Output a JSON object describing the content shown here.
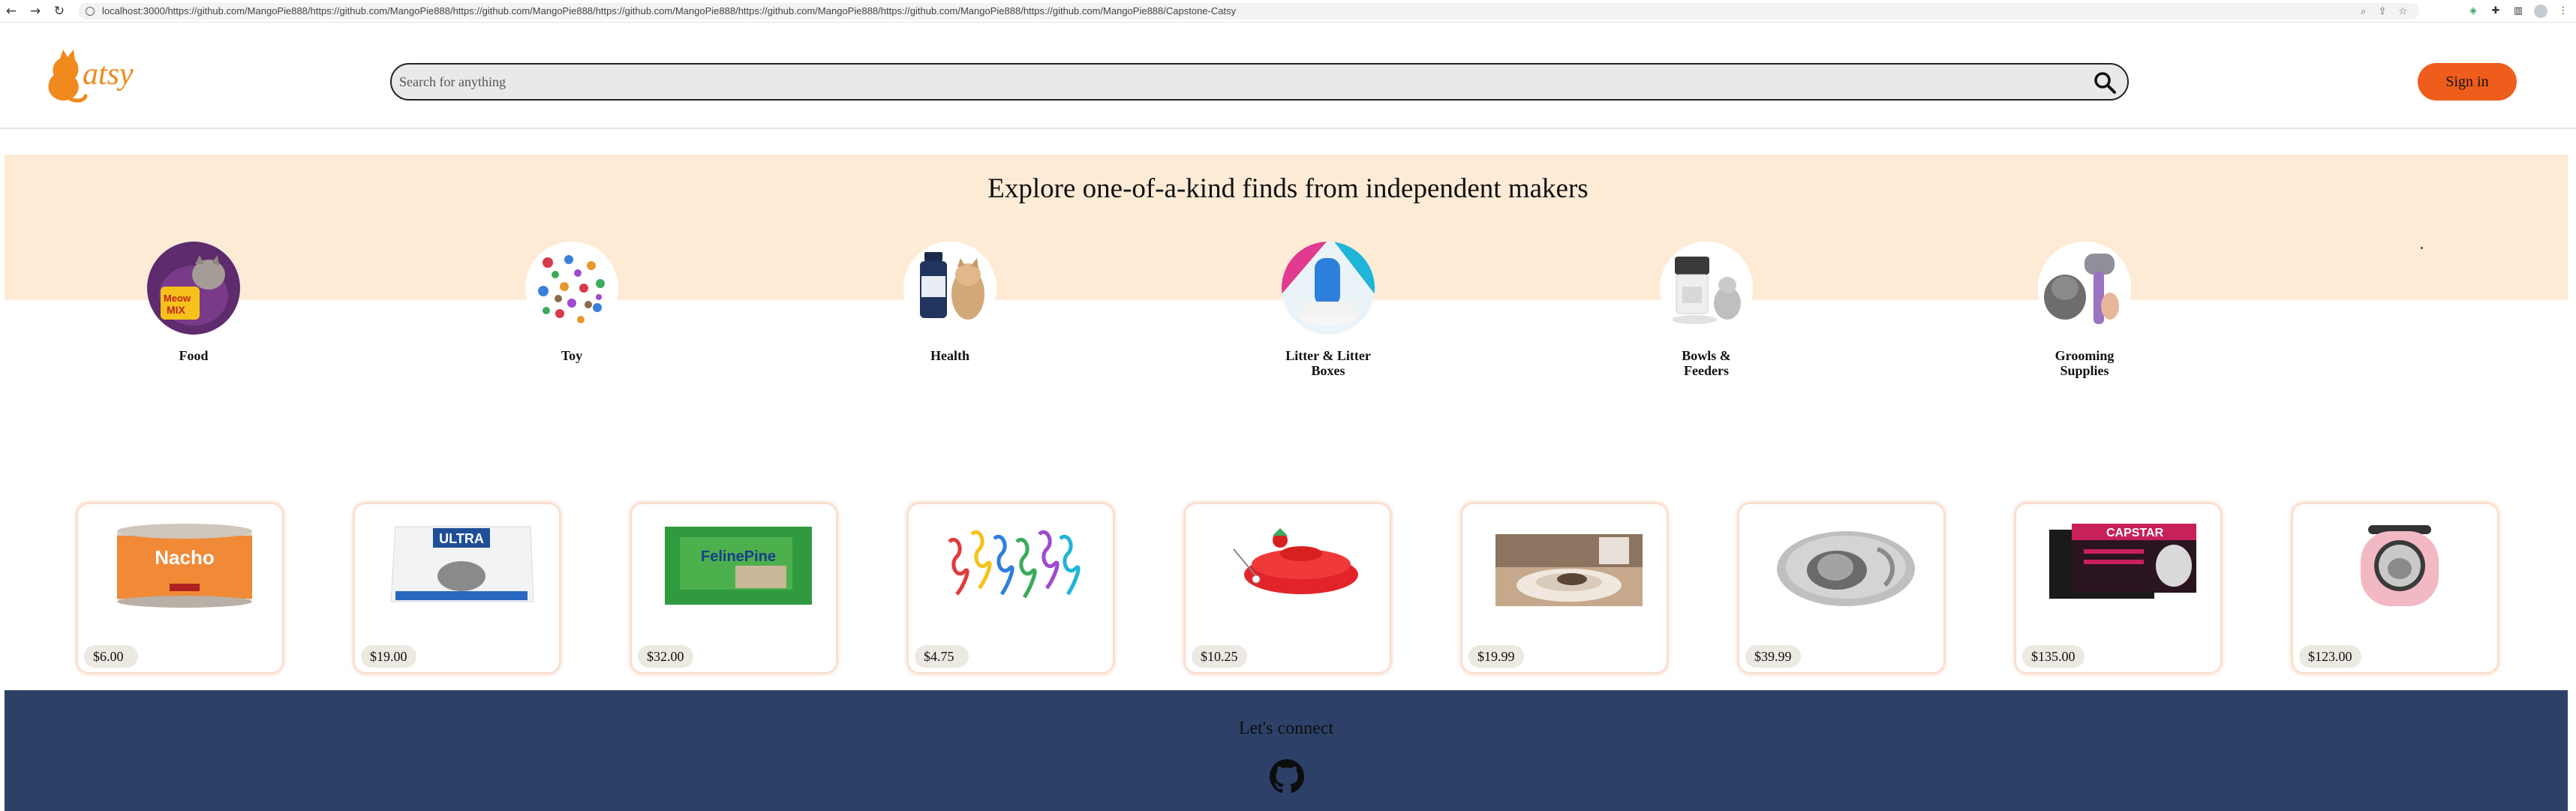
{
  "browser": {
    "url": "localhost:3000/https://github.com/MangoPie888/https://github.com/MangoPie888/https://github.com/MangoPie888/https://github.com/MangoPie888/https://github.com/MangoPie888/https://github.com/MangoPie888/https://github.com/MangoPie888/Capstone-Catsy",
    "back_icon": "←",
    "forward_icon": "→",
    "reload_icon": "↻"
  },
  "header": {
    "logo_text": "atsy",
    "search_placeholder": "Search for anything",
    "signin_label": "Sign in",
    "accent_color": "#ee5d1b"
  },
  "hero": {
    "title": "Explore one-of-a-kind finds from independent makers",
    "background": "#fdebd6",
    "categories": [
      {
        "label": "Food"
      },
      {
        "label": "Toy"
      },
      {
        "label": "Health"
      },
      {
        "label": "Litter & Litter Boxes"
      },
      {
        "label": "Bowls & Feeders"
      },
      {
        "label": "Grooming Supplies"
      }
    ]
  },
  "products": [
    {
      "price": "$6.00",
      "label": "Nacho"
    },
    {
      "price": "$19.00",
      "label": "ULTRA"
    },
    {
      "price": "$32.00",
      "label": "FelinePine"
    },
    {
      "price": "$4.75"
    },
    {
      "price": "$10.25"
    },
    {
      "price": "$19.99"
    },
    {
      "price": "$39.99"
    },
    {
      "price": "$135.00",
      "label": "CAPSTAR"
    },
    {
      "price": "$123.00"
    }
  ],
  "footer": {
    "heading": "Let's connect",
    "background": "#2d4168",
    "icon": "github-icon"
  }
}
